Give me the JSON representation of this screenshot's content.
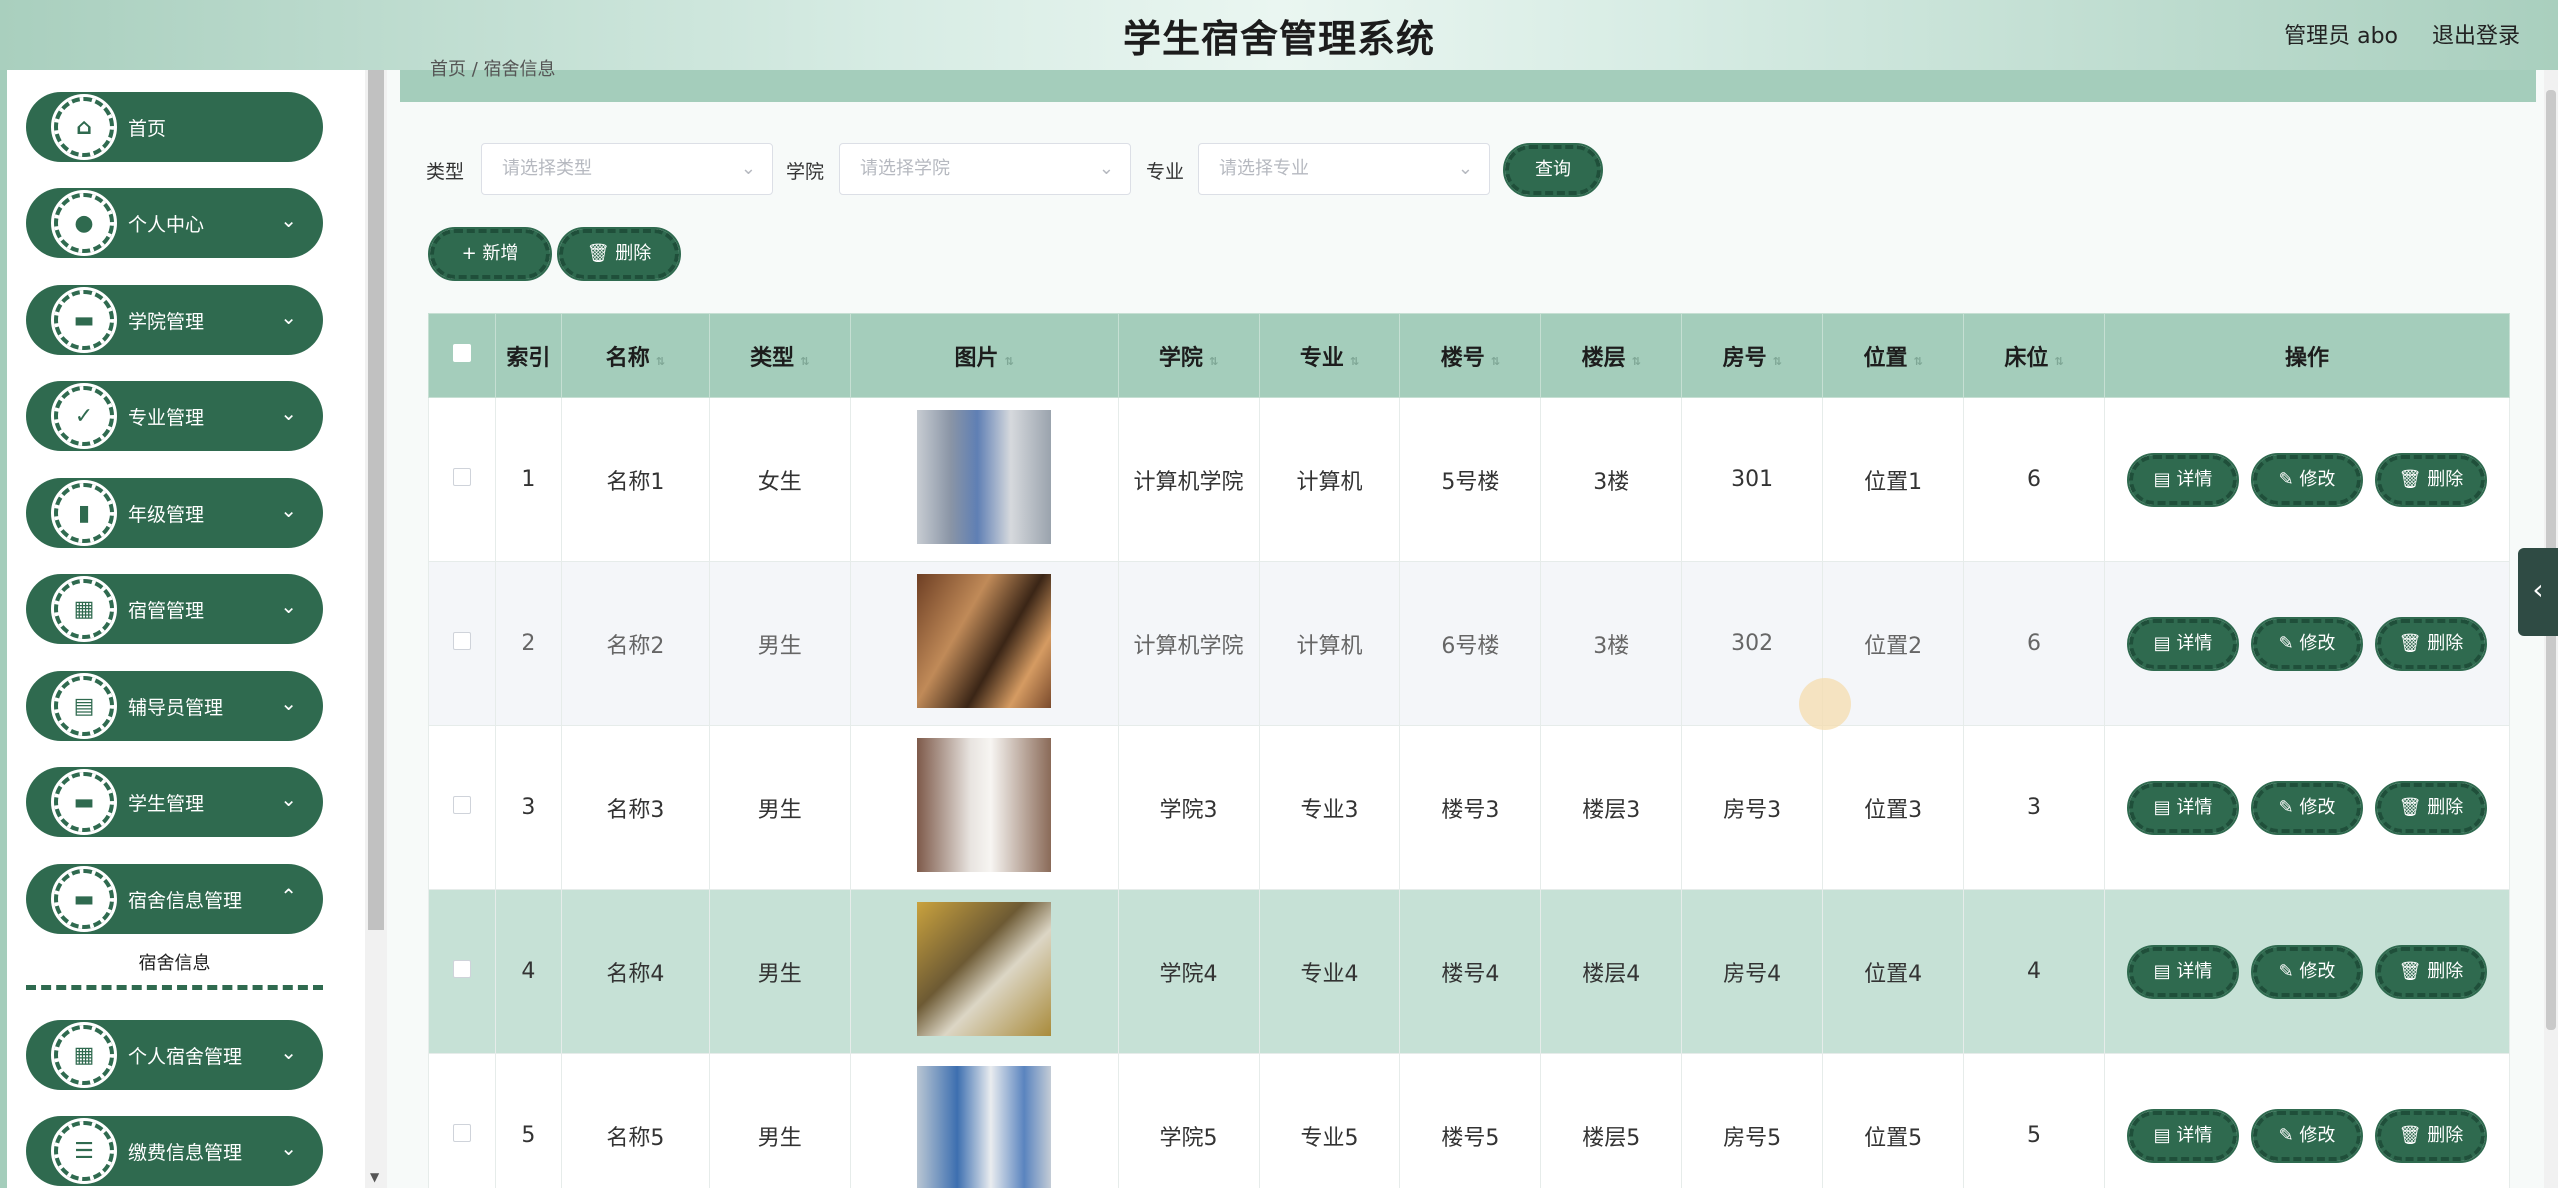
{
  "header": {
    "title": "学生宿舍管理系统",
    "user": "管理员 abo",
    "logout": "退出登录"
  },
  "sidebar": {
    "items": [
      {
        "label": "首页",
        "icon": "home-icon",
        "glyph": "⌂",
        "chevron": ""
      },
      {
        "label": "个人中心",
        "icon": "user-icon",
        "glyph": "●",
        "chevron": "⌄"
      },
      {
        "label": "学院管理",
        "icon": "briefcase-icon",
        "glyph": "▬",
        "chevron": "⌄"
      },
      {
        "label": "专业管理",
        "icon": "clipboard-check-icon",
        "glyph": "✓",
        "chevron": "⌄"
      },
      {
        "label": "年级管理",
        "icon": "bar-chart-icon",
        "glyph": "▮",
        "chevron": "⌄"
      },
      {
        "label": "宿管管理",
        "icon": "grid-icon",
        "glyph": "▦",
        "chevron": "⌄"
      },
      {
        "label": "辅导员管理",
        "icon": "clipboard-icon",
        "glyph": "▤",
        "chevron": "⌄"
      },
      {
        "label": "学生管理",
        "icon": "monitor-icon",
        "glyph": "▬",
        "chevron": "⌄"
      },
      {
        "label": "宿舍信息管理",
        "icon": "monitor-icon",
        "glyph": "▬",
        "chevron": "⌃"
      },
      {
        "label": "个人宿舍管理",
        "icon": "grid-icon",
        "glyph": "▦",
        "chevron": "⌄"
      },
      {
        "label": "缴费信息管理",
        "icon": "list-icon",
        "glyph": "☰",
        "chevron": "⌄"
      }
    ],
    "sub_item": "宿舍信息"
  },
  "breadcrumb": "首页 / 宿舍信息",
  "filters": {
    "type_label": "类型",
    "type_placeholder": "请选择类型",
    "college_label": "学院",
    "college_placeholder": "请选择学院",
    "major_label": "专业",
    "major_placeholder": "请选择专业",
    "query": "查询"
  },
  "actions": {
    "add": "+ 新增",
    "delete": "🗑 删除"
  },
  "table": {
    "headers": [
      "索引",
      "名称",
      "类型",
      "图片",
      "学院",
      "专业",
      "楼号",
      "楼层",
      "房号",
      "位置",
      "床位",
      "操作"
    ],
    "rows": [
      {
        "index": "1",
        "name": "名称1",
        "type": "女生",
        "college": "计算机学院",
        "major": "计算机",
        "building": "5号楼",
        "floor": "3楼",
        "room": "301",
        "position": "位置1",
        "beds": "6"
      },
      {
        "index": "2",
        "name": "名称2",
        "type": "男生",
        "college": "计算机学院",
        "major": "计算机",
        "building": "6号楼",
        "floor": "3楼",
        "room": "302",
        "position": "位置2",
        "beds": "6"
      },
      {
        "index": "3",
        "name": "名称3",
        "type": "男生",
        "college": "学院3",
        "major": "专业3",
        "building": "楼号3",
        "floor": "楼层3",
        "room": "房号3",
        "position": "位置3",
        "beds": "3"
      },
      {
        "index": "4",
        "name": "名称4",
        "type": "男生",
        "college": "学院4",
        "major": "专业4",
        "building": "楼号4",
        "floor": "楼层4",
        "room": "房号4",
        "position": "位置4",
        "beds": "4"
      },
      {
        "index": "5",
        "name": "名称5",
        "type": "男生",
        "college": "学院5",
        "major": "专业5",
        "building": "楼号5",
        "floor": "楼层5",
        "room": "房号5",
        "position": "位置5",
        "beds": "5"
      }
    ],
    "op_detail": "▤ 详情",
    "op_edit": "✎ 修改",
    "op_delete": "🗑 删除"
  },
  "colors": {
    "primary": "#2f6a4f",
    "header_bg": "#a4cdbb",
    "highlight_row": "#c6e1d6"
  }
}
